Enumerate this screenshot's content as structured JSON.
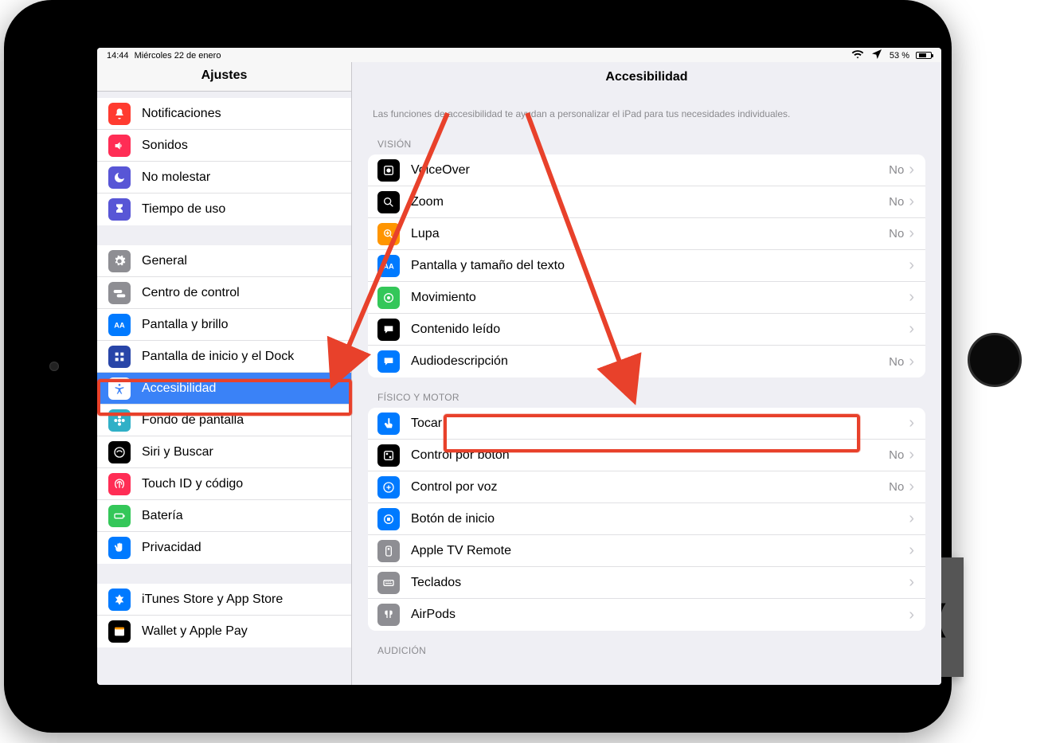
{
  "status": {
    "time": "14:44",
    "date": "Miércoles 22 de enero",
    "battery_pct": "53 %"
  },
  "sidebar": {
    "title": "Ajustes",
    "groups": [
      {
        "items": [
          {
            "id": "notifications",
            "icon": "bell-icon",
            "color": "bg-red",
            "label": "Notificaciones"
          },
          {
            "id": "sounds",
            "icon": "speaker-icon",
            "color": "bg-pink",
            "label": "Sonidos"
          },
          {
            "id": "dnd",
            "icon": "moon-icon",
            "color": "bg-purple",
            "label": "No molestar"
          },
          {
            "id": "screentime",
            "icon": "hourglass-icon",
            "color": "bg-purple",
            "label": "Tiempo de uso"
          }
        ]
      },
      {
        "items": [
          {
            "id": "general",
            "icon": "gear-icon",
            "color": "bg-grey",
            "label": "General"
          },
          {
            "id": "controlcenter",
            "icon": "toggles-icon",
            "color": "bg-grey",
            "label": "Centro de control"
          },
          {
            "id": "display",
            "icon": "aa-icon",
            "color": "bg-blue",
            "label": "Pantalla y brillo"
          },
          {
            "id": "homescreen",
            "icon": "grid-icon",
            "color": "bg-darkblue",
            "label": "Pantalla de inicio y el Dock"
          },
          {
            "id": "accessibility",
            "icon": "accessibility-icon",
            "color": "bg-blue",
            "label": "Accesibilidad",
            "selected": true
          },
          {
            "id": "wallpaper",
            "icon": "flower-icon",
            "color": "bg-teal",
            "label": "Fondo de pantalla"
          },
          {
            "id": "siri",
            "icon": "siri-icon",
            "color": "bg-black",
            "label": "Siri y Buscar"
          },
          {
            "id": "touchid",
            "icon": "fingerprint-icon",
            "color": "bg-pink",
            "label": "Touch ID y código"
          },
          {
            "id": "battery",
            "icon": "battery-icon",
            "color": "bg-green",
            "label": "Batería"
          },
          {
            "id": "privacy",
            "icon": "hand-icon",
            "color": "bg-blue",
            "label": "Privacidad"
          }
        ]
      },
      {
        "items": [
          {
            "id": "itunes",
            "icon": "appstore-icon",
            "color": "bg-blue",
            "label": "iTunes Store y App Store"
          },
          {
            "id": "wallet",
            "icon": "wallet-icon",
            "color": "bg-black",
            "label": "Wallet y Apple Pay"
          }
        ]
      }
    ]
  },
  "detail": {
    "title": "Accesibilidad",
    "hint": "Las funciones de accesibilidad te ayudan a personalizar el iPad para tus necesidades individuales.",
    "sections": [
      {
        "header": "VISIÓN",
        "items": [
          {
            "id": "voiceover",
            "icon": "voiceover-icon",
            "color": "bg-black",
            "label": "VoiceOver",
            "value": "No"
          },
          {
            "id": "zoom",
            "icon": "zoom-icon",
            "color": "bg-black",
            "label": "Zoom",
            "value": "No"
          },
          {
            "id": "magnifier",
            "icon": "magnifier-icon",
            "color": "bg-orange",
            "label": "Lupa",
            "value": "No"
          },
          {
            "id": "textsize",
            "icon": "aa-icon",
            "color": "bg-blue",
            "label": "Pantalla y tamaño del texto"
          },
          {
            "id": "motion",
            "icon": "motion-icon",
            "color": "bg-green",
            "label": "Movimiento"
          },
          {
            "id": "spoken",
            "icon": "speech-icon",
            "color": "bg-black",
            "label": "Contenido leído"
          },
          {
            "id": "audiodesc",
            "icon": "audiodesc-icon",
            "color": "bg-blue",
            "label": "Audiodescripción",
            "value": "No"
          }
        ]
      },
      {
        "header": "FÍSICO Y MOTOR",
        "items": [
          {
            "id": "touch",
            "icon": "touch-icon",
            "color": "bg-blue",
            "label": "Tocar"
          },
          {
            "id": "switchcontrol",
            "icon": "switch-icon",
            "color": "bg-black",
            "label": "Control por botón",
            "value": "No"
          },
          {
            "id": "voicecontrol",
            "icon": "voicecontrol-icon",
            "color": "bg-blue",
            "label": "Control por voz",
            "value": "No"
          },
          {
            "id": "homebutton",
            "icon": "homebutton-icon",
            "color": "bg-blue",
            "label": "Botón de inicio"
          },
          {
            "id": "appletv",
            "icon": "appletv-icon",
            "color": "bg-grey",
            "label": "Apple TV Remote"
          },
          {
            "id": "keyboards",
            "icon": "keyboard-icon",
            "color": "bg-grey",
            "label": "Teclados"
          },
          {
            "id": "airpods",
            "icon": "airpods-icon",
            "color": "bg-grey",
            "label": "AirPods"
          }
        ]
      },
      {
        "header": "AUDICIÓN",
        "items": []
      }
    ]
  }
}
